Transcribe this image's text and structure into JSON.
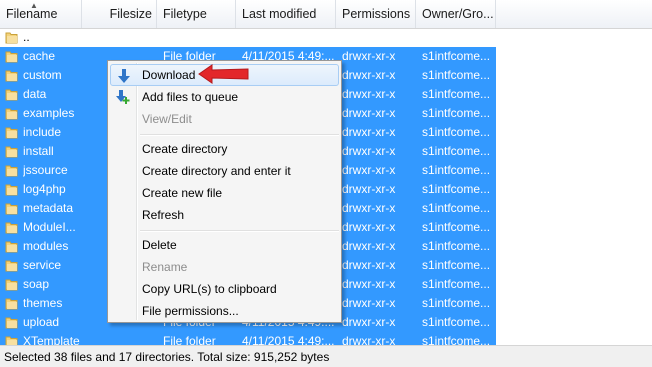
{
  "columns": [
    "Filename",
    "Filesize",
    "Filetype",
    "Last modified",
    "Permissions",
    "Owner/Gro..."
  ],
  "rows": [
    {
      "name": "..",
      "selected": false
    },
    {
      "name": "cache",
      "filetype": "File folder",
      "modified": "4/11/2015 4:49:...",
      "permissions": "drwxr-xr-x",
      "owner": "s1intfcome...",
      "selected": true
    },
    {
      "name": "custom",
      "filetype": "",
      "modified": "",
      "permissions": "drwxr-xr-x",
      "owner": "s1intfcome...",
      "selected": true
    },
    {
      "name": "data",
      "filetype": "",
      "modified": "",
      "permissions": "drwxr-xr-x",
      "owner": "s1intfcome...",
      "selected": true
    },
    {
      "name": "examples",
      "filetype": "",
      "modified": "",
      "permissions": "drwxr-xr-x",
      "owner": "s1intfcome...",
      "selected": true
    },
    {
      "name": "include",
      "filetype": "",
      "modified": "",
      "permissions": "drwxr-xr-x",
      "owner": "s1intfcome...",
      "selected": true
    },
    {
      "name": "install",
      "filetype": "",
      "modified": "",
      "permissions": "drwxr-xr-x",
      "owner": "s1intfcome...",
      "selected": true
    },
    {
      "name": "jssource",
      "filetype": "",
      "modified": "",
      "permissions": "drwxr-xr-x",
      "owner": "s1intfcome...",
      "selected": true
    },
    {
      "name": "log4php",
      "filetype": "",
      "modified": "",
      "permissions": "drwxr-xr-x",
      "owner": "s1intfcome...",
      "selected": true
    },
    {
      "name": "metadata",
      "filetype": "",
      "modified": "",
      "permissions": "drwxr-xr-x",
      "owner": "s1intfcome...",
      "selected": true
    },
    {
      "name": "ModuleI...",
      "filetype": "",
      "modified": "",
      "permissions": "drwxr-xr-x",
      "owner": "s1intfcome...",
      "selected": true
    },
    {
      "name": "modules",
      "filetype": "",
      "modified": "",
      "permissions": "drwxr-xr-x",
      "owner": "s1intfcome...",
      "selected": true
    },
    {
      "name": "service",
      "filetype": "",
      "modified": "",
      "permissions": "drwxr-xr-x",
      "owner": "s1intfcome...",
      "selected": true
    },
    {
      "name": "soap",
      "filetype": "",
      "modified": "",
      "permissions": "drwxr-xr-x",
      "owner": "s1intfcome...",
      "selected": true
    },
    {
      "name": "themes",
      "filetype": "",
      "modified": "",
      "permissions": "drwxr-xr-x",
      "owner": "s1intfcome...",
      "selected": true
    },
    {
      "name": "upload",
      "filetype": "File folder",
      "modified": "4/11/2015 4:49:...",
      "permissions": "drwxr-xr-x",
      "owner": "s1intfcome...",
      "selected": true
    },
    {
      "name": "XTemplate",
      "filetype": "File folder",
      "modified": "4/11/2015 4:49:...",
      "permissions": "drwxr-xr-x",
      "owner": "s1intfcome...",
      "selected": true
    }
  ],
  "context_menu": {
    "download": "Download",
    "add_to_queue": "Add files to queue",
    "view_edit": "View/Edit",
    "create_directory": "Create directory",
    "create_directory_enter": "Create directory and enter it",
    "create_new_file": "Create new file",
    "refresh": "Refresh",
    "delete": "Delete",
    "rename": "Rename",
    "copy_urls": "Copy URL(s) to clipboard",
    "file_permissions": "File permissions..."
  },
  "status": "Selected 38 files and 17 directories. Total size: 915,252 bytes",
  "colors": {
    "selection": "#3399ff",
    "menu_background": "#f5f5f5",
    "menu_highlight": "#dcebfc",
    "callout_arrow": "#e3272a",
    "download_icon": "#2f75c8",
    "queue_icon_plus": "#36a832"
  },
  "icons": {
    "folder": "folder-icon",
    "download": "download-arrow-icon",
    "add_to_queue": "add-to-queue-icon",
    "callout": "red-callout-arrow"
  }
}
